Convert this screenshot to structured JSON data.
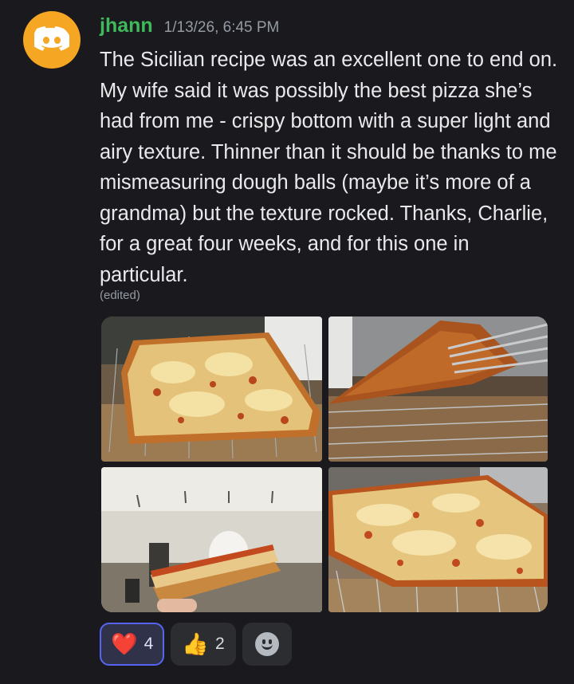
{
  "message": {
    "username": "jhann",
    "timestamp": "1/13/26, 6:45 PM",
    "text": "The Sicilian recipe was an excellent one to end on. My wife said it was possibly the best pizza she’s had from me - crispy bottom with a super light and airy texture. Thinner than it should be thanks to me mismeasuring dough balls (maybe it’s more of a grandma) but the texture rocked. Thanks, Charlie, for a great four weeks, and for this one in particular.",
    "edited": "(edited)",
    "avatar_icon": "discord-logo-icon"
  },
  "gallery": {
    "images": [
      {
        "name": "pizza-on-rack-photo"
      },
      {
        "name": "pizza-underside-spatula-photo"
      },
      {
        "name": "pizza-slice-hand-photo"
      },
      {
        "name": "pizza-full-sheet-photo"
      }
    ]
  },
  "reactions": [
    {
      "emoji": "❤️",
      "count": "4",
      "active": true,
      "icon": "heart-icon"
    },
    {
      "emoji": "👍",
      "count": "2",
      "active": false,
      "icon": "thumbs-up-icon"
    }
  ],
  "add_reaction_icon": "add-reaction-smile-icon",
  "colors": {
    "background": "#1a1a1e",
    "username": "#3fb95a",
    "avatar": "#f5a623",
    "reaction_active_border": "#5865f2"
  }
}
